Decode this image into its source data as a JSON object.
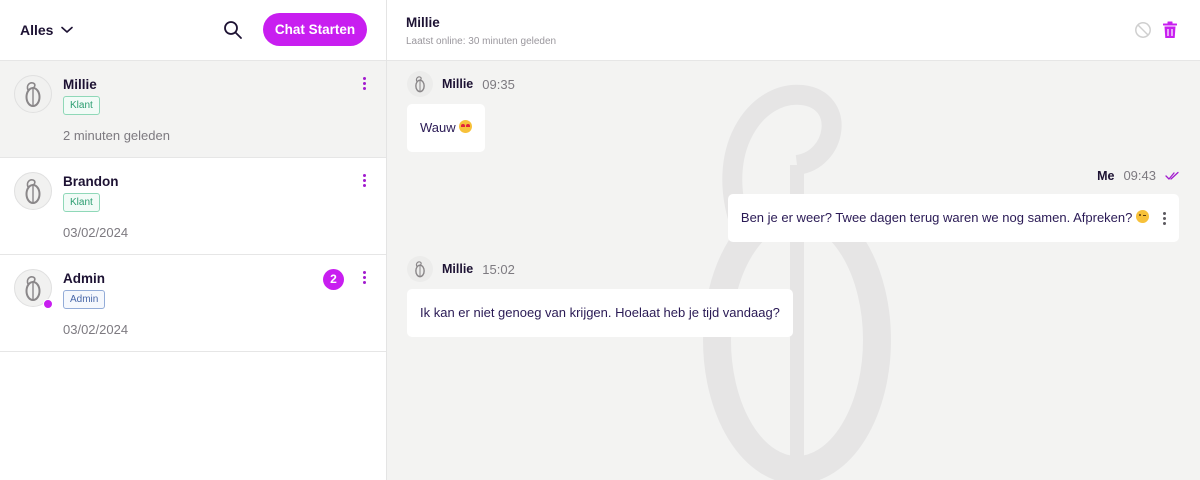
{
  "sidebar": {
    "filter_label": "Alles",
    "start_chat_label": "Chat Starten",
    "conversations": [
      {
        "name": "Millie",
        "badge": "Klant",
        "time": "2 minuten geleden"
      },
      {
        "name": "Brandon",
        "badge": "Klant",
        "time": "03/02/2024"
      },
      {
        "name": "Admin",
        "badge": "Admin",
        "time": "03/02/2024",
        "unread": "2"
      }
    ]
  },
  "chat": {
    "title": "Millie",
    "last_online": "Laatst online: 30 minuten geleden",
    "messages": [
      {
        "sender": "Millie",
        "time": "09:35",
        "text": "Wauw"
      },
      {
        "sender": "Me",
        "time": "09:43",
        "text": "Ben je er weer? Twee dagen terug waren we nog samen. Afpreken?"
      },
      {
        "sender": "Millie",
        "time": "15:02",
        "text": "Ik kan er niet genoeg van krijgen. Hoelaat heb je tijd vandaag?"
      }
    ]
  },
  "colors": {
    "accent": "#c81ef0",
    "active_row": "#f3f3f2",
    "klant_badge": "#2b9d70",
    "admin_badge": "#4867a8"
  },
  "icons": [
    "chevron-down-icon",
    "search-icon",
    "kebab-icon",
    "block-icon",
    "trash-icon",
    "double-check-icon",
    "logo-monogram-icon"
  ]
}
